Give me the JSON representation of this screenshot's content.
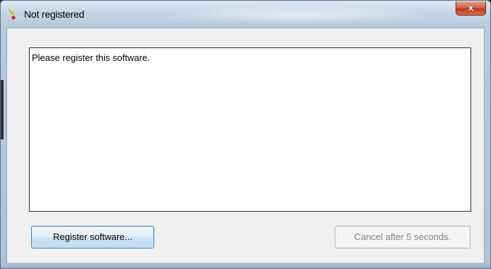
{
  "window": {
    "title": "Not registered",
    "close_label": "x"
  },
  "message": {
    "text": "Please register this software."
  },
  "buttons": {
    "register_label": "Register software...",
    "cancel_label": "Cancel after 5 seconds."
  },
  "icons": {
    "app": "app-icon",
    "close": "close-icon"
  },
  "colors": {
    "titlebar": "#c6d6e7",
    "close_button": "#c0381d",
    "client_background": "#f0f0f0",
    "register_border": "#3c7fb1",
    "cancel_text_disabled": "#838383"
  }
}
